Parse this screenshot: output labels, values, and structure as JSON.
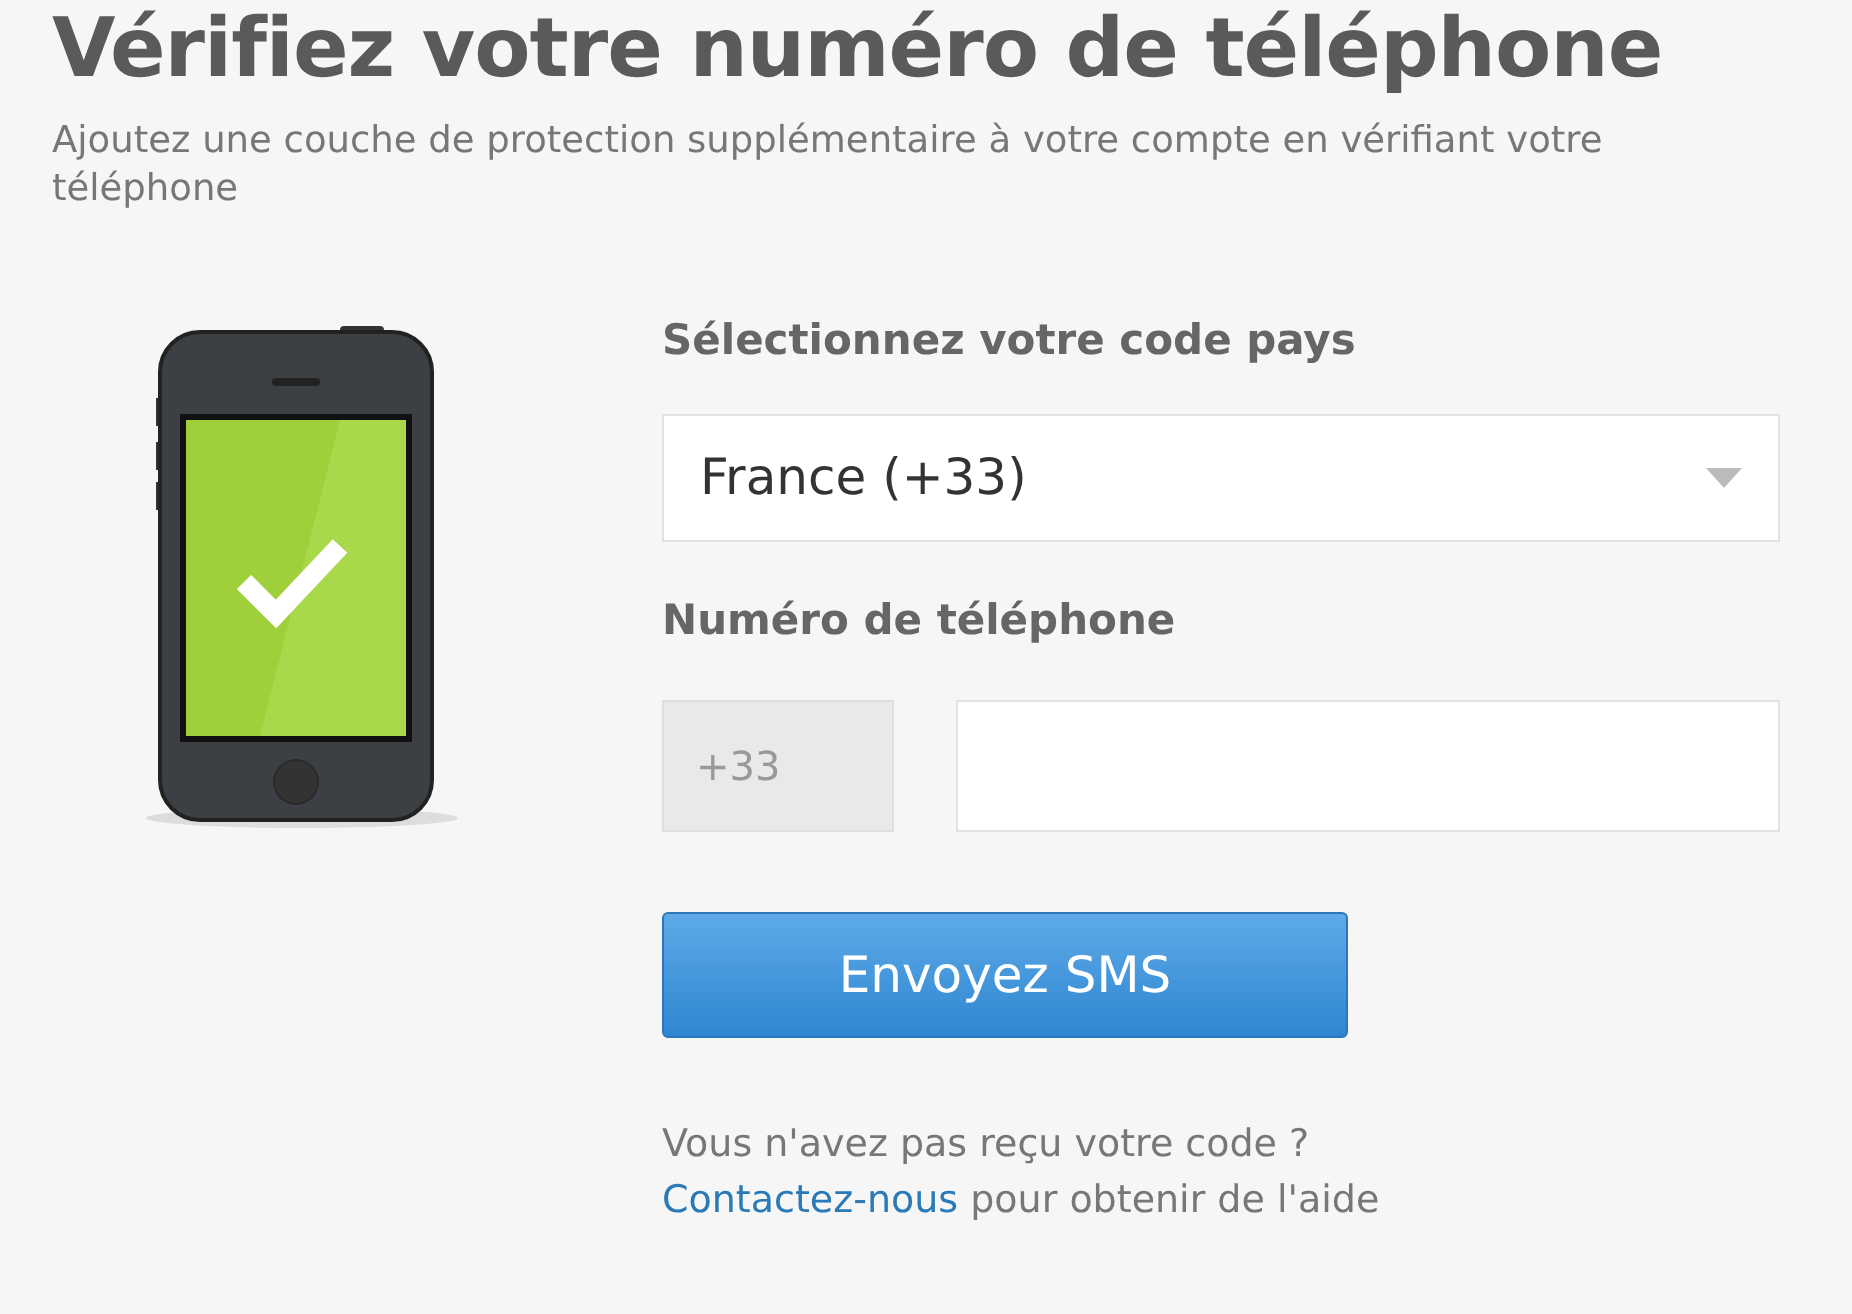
{
  "title": "Vérifiez votre numéro de téléphone",
  "subtitle": "Ajoutez une couche de protection supplémentaire à votre compte en vérifiant votre téléphone",
  "country_label": "Sélectionnez votre code pays",
  "country_select": {
    "value": "France (+33)"
  },
  "phone_label": "Numéro de téléphone",
  "prefix": "+33",
  "send_button": "Envoyez SMS",
  "help": {
    "question": "Vous n'avez pas reçu votre code ?",
    "link": "Contactez-nous",
    "rest": "pour obtenir de l'aide"
  }
}
